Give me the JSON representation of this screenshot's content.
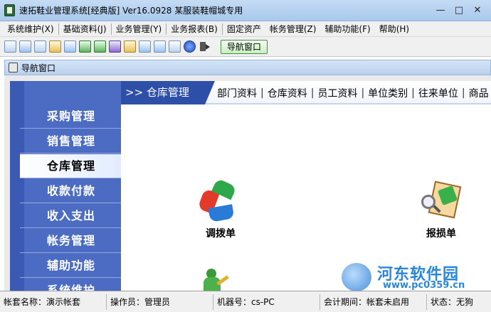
{
  "window": {
    "title": "速拓鞋业管理系统[经典版] Ver16.0928   某服装鞋帽城专用",
    "minimize": "—",
    "maximize": "□",
    "close": "✕"
  },
  "menu": [
    {
      "label": "系统维护(X)"
    },
    {
      "label": "基础资料(J)"
    },
    {
      "label": "业务管理(Y)"
    },
    {
      "label": "业务报表(B)"
    },
    {
      "label": "固定资产"
    },
    {
      "label": "帐务管理(Z)"
    },
    {
      "label": "辅助功能(F)"
    },
    {
      "label": "帮助(H)"
    }
  ],
  "toolbar": {
    "nav_button_label": "导航窗口"
  },
  "child_window": {
    "title": "导航窗口"
  },
  "left_nav": {
    "items": [
      {
        "label": "采购管理"
      },
      {
        "label": "销售管理"
      },
      {
        "label": "仓库管理"
      },
      {
        "label": "收款付款"
      },
      {
        "label": "收入支出"
      },
      {
        "label": "帐务管理"
      },
      {
        "label": "辅助功能"
      },
      {
        "label": "系统维护"
      }
    ],
    "active_index": 2
  },
  "panel": {
    "title": ">> 仓库管理",
    "links": [
      "部门资料",
      "仓库资料",
      "员工资料",
      "单位类别",
      "往来单位",
      "商品"
    ],
    "functions": [
      {
        "label": "调拨单",
        "icon": "recycle-icon"
      },
      {
        "label": "报损单",
        "icon": "report-loss-icon"
      }
    ]
  },
  "watermark": {
    "name": "河东软件园",
    "url": "www.pc0359.cn"
  },
  "status": {
    "account": "帐套名称：演示帐套",
    "operator": "操作员：管理员",
    "machine": "机器号：cs-PC",
    "period": "会计期间：帐套未启用",
    "state": "状态：无狗"
  }
}
